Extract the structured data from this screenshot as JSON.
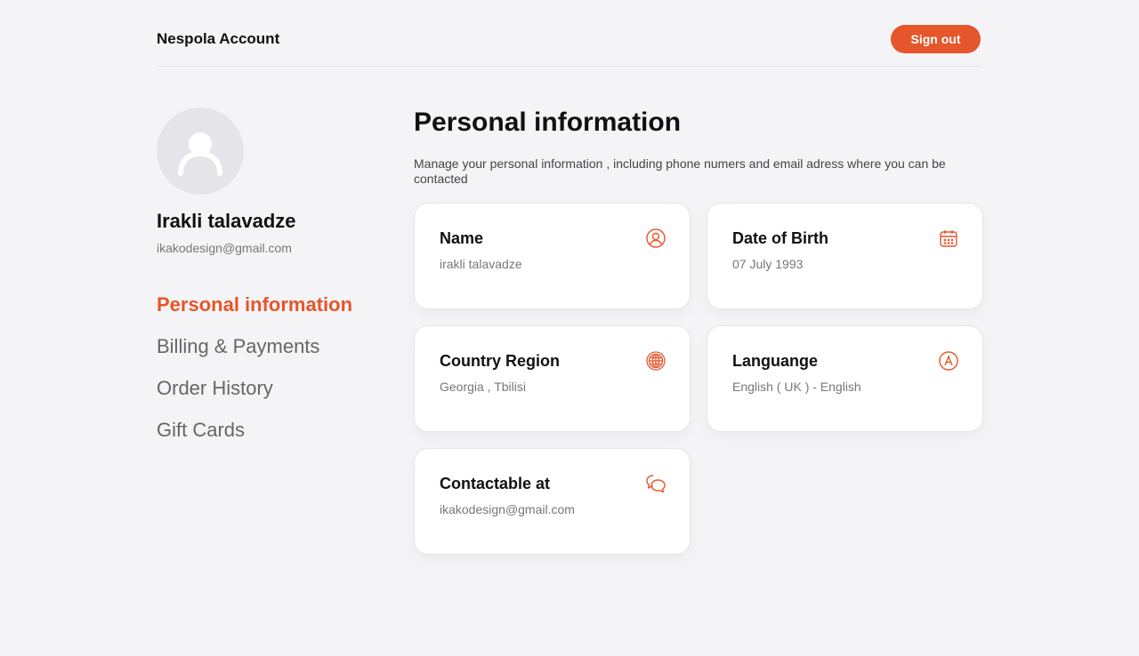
{
  "header": {
    "brand": "Nespola Account",
    "signout_label": "Sign out"
  },
  "profile": {
    "name": "Irakli talavadze",
    "email": "ikakodesign@gmail.com"
  },
  "nav": {
    "items": [
      {
        "label": "Personal information",
        "active": true
      },
      {
        "label": "Billing & Payments",
        "active": false
      },
      {
        "label": "Order History",
        "active": false
      },
      {
        "label": "Gift Cards",
        "active": false
      }
    ]
  },
  "main": {
    "title": "Personal information",
    "description": "Manage your personal information , including phone numers and email adress where you can be contacted",
    "cards": [
      {
        "title": "Name",
        "value": "irakli talavadze",
        "icon": "user-icon"
      },
      {
        "title": "Date of Birth",
        "value": "07 July 1993",
        "icon": "calendar-icon"
      },
      {
        "title": "Country Region",
        "value": "Georgia , Tbilisi",
        "icon": "globe-icon"
      },
      {
        "title": "Languange",
        "value": "English ( UK ) - English",
        "icon": "language-icon"
      },
      {
        "title": "Contactable at",
        "value": "ikakodesign@gmail.com",
        "icon": "chat-icon"
      }
    ]
  },
  "colors": {
    "accent": "#e5562a",
    "background": "#f4f4f6"
  }
}
